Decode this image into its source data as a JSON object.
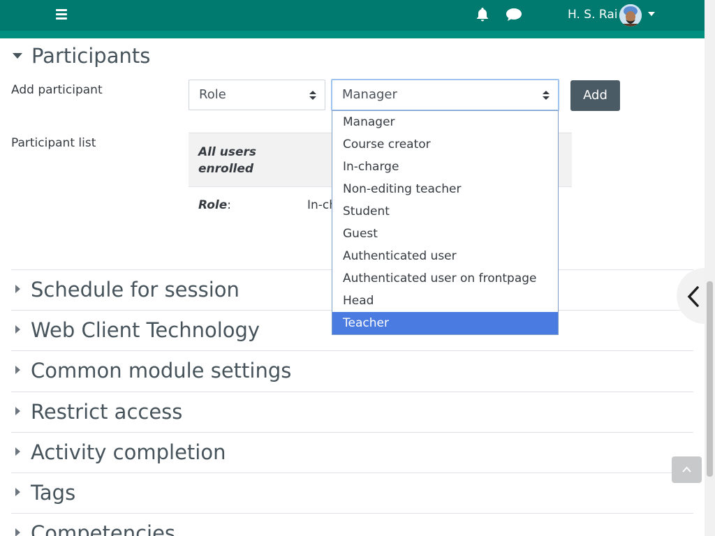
{
  "navbar": {
    "menu_icon": "hamburger-icon",
    "notifications_icon": "bell-icon",
    "messages_icon": "chat-icon",
    "user_name": "H. S. Rai"
  },
  "participants": {
    "title": "Participants",
    "add_label": "Add participant",
    "type_select_value": "Role",
    "role_select_value": "Manager",
    "add_button": "Add",
    "list_label": "Participant list",
    "table_header": "All users enrolled",
    "row_label": "Role",
    "row_colon": ":",
    "row_value": "In-ch"
  },
  "dropdown": {
    "options": [
      "Manager",
      "Course creator",
      "In-charge",
      "Non-editing teacher",
      "Student",
      "Guest",
      "Authenticated user",
      "Authenticated user on frontpage",
      "Head",
      "Teacher"
    ],
    "highlighted": "Teacher"
  },
  "sections": [
    "Schedule for session",
    "Web Client Technology",
    "Common module settings",
    "Restrict access",
    "Activity completion",
    "Tags",
    "Competencies"
  ],
  "colors": {
    "navbar": "#007a6f",
    "highlight": "#4a7be0",
    "button": "#4b5b66"
  }
}
